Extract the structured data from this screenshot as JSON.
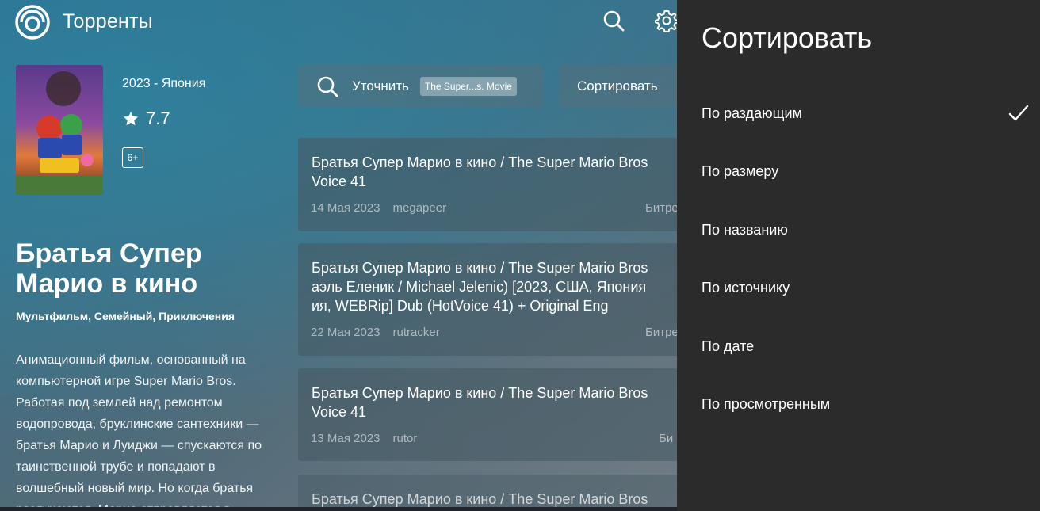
{
  "app": {
    "title": "Торренты"
  },
  "movie": {
    "year_country": "2023 - Япония",
    "rating": "7.7",
    "age": "6+",
    "title": "Братья Супер Марио в кино",
    "genres": "Мультфильм, Семейный, Приключения",
    "description": "Анимационный фильм, основанный на компьютерной игре Super Mario Bros. Работая под землей над ремонтом водопровода, бруклинские сантехники — братья Марио и Луиджи — спускаются по таинственной трубе и попадают в волшебный новый мир. Но когда братья разлучаются, Марио отправляется в"
  },
  "filters": {
    "refine_label": "Уточнить",
    "refine_chip": "The Super...s. Movie",
    "sort_label": "Сортировать"
  },
  "torrents": [
    {
      "title": "Братья Супер Марио в кино / The Super Mario Bros\nVoice 41",
      "date": "14 Мая 2023",
      "tracker": "megapeer",
      "extra": "Битре"
    },
    {
      "title": "Братья Супер Марио в кино / The Super Mario Bros\nаэль Еленик / Michael Jelenic) [2023, США, Япония\nия, WEBRip] Dub (HotVoice 41) + Original Eng",
      "date": "22 Мая 2023",
      "tracker": "rutracker",
      "extra": "Битре"
    },
    {
      "title": "Братья Супер Марио в кино / The Super Mario Bros\nVoice 41",
      "date": "13 Мая 2023",
      "tracker": "rutor",
      "extra": "Би"
    },
    {
      "title": "Братья Супер Марио в кино / The Super Mario Bros",
      "date": "",
      "tracker": "",
      "extra": ""
    }
  ],
  "sort_panel": {
    "heading": "Сортировать",
    "options": [
      {
        "label": "По раздающим",
        "selected": true
      },
      {
        "label": "По размеру",
        "selected": false
      },
      {
        "label": "По названию",
        "selected": false
      },
      {
        "label": "По источнику",
        "selected": false
      },
      {
        "label": "По дате",
        "selected": false
      },
      {
        "label": "По просмотренным",
        "selected": false
      }
    ]
  },
  "icons": {
    "logo": "app-logo-icon",
    "search": "search-icon",
    "settings": "gear-icon",
    "star": "star-icon",
    "check": "checkmark-icon"
  },
  "colors": {
    "panel_bg": "#2b2b2b",
    "card_bg": "rgba(70,90,100,0.6)",
    "accent_text": "#ffffff"
  }
}
